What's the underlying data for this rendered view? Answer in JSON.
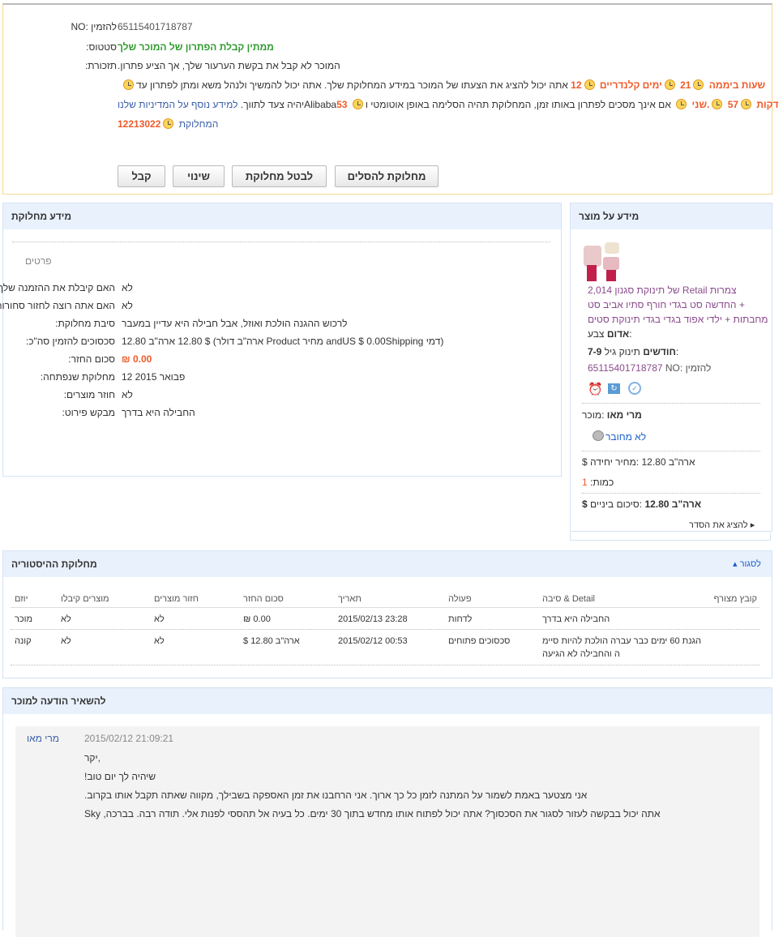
{
  "top": {
    "order_label": "NO: להזמין",
    "order_value": "65115401718787",
    "status_label": ":סטטוס",
    "status_value": "ממתין קבלת הפתרון של המוכר שלך",
    "reminder_label": ":תזכורת",
    "reminder_value": ".המוכר לא קבל את בקשת הערעור שלך, אך הציע פתרון",
    "line1_text": "אתה יכול להציג את הצעתו של המוכר במידע המחלוקת שלך. אתה יכול להמשיך ולנהל משא ומתן לפתרון עד",
    "line1_parts": [
      "12",
      "ימים קלנדריים",
      "21",
      "שעות ביממה"
    ],
    "line2_end": "יהיה צעד לתווך.",
    "line2_link": "למידע נוסף על המדיניות שלנו",
    "line2_brand": "Alibaba",
    "line2_parts": [
      "53",
      "דקות",
      "57",
      ".שני"
    ],
    "line2_text": "אם אינך מסכים לפתרון באותו זמן, המחלוקת תהיה הסלימה באופן אוטומטי ו",
    "line3_num": "12213022",
    "line3_link": "המחלוקת",
    "buttons": {
      "accept": "קבל",
      "modify": "שינוי",
      "cancel": "לבטל מחלוקת",
      "escalate": "מחלוקת להסלים"
    }
  },
  "dispute": {
    "title": "מידע מחלוקת",
    "section": "פרטים",
    "rows": [
      {
        "label": "האם קיבלת את ההזמנה שלך",
        "value": "לא"
      },
      {
        "label": "האם אתה רוצה לחזור סחורות",
        "value": "לא"
      },
      {
        "label": ":סיבת מחלוקת",
        "value": "לרכוש ההגנה הולכת ואוזל, אבל חבילה היא עדיין במעבר"
      },
      {
        "label": ":סכסוכים להזמין סה\"כ",
        "value": "12.80 ארה\"ב דולר) $ 12.80 ארה\"ב Product מחיר andUS $ 0.00Shipping דמי)"
      },
      {
        "label": ":סכום החזר",
        "value": "₪ 0.00"
      },
      {
        "label": ":מחלוקת שנפתחה",
        "value": "12 2015 פבואר"
      },
      {
        "label": ":חוזר מוצרים",
        "value": "לא"
      },
      {
        "label": ":מבקש פירוט",
        "value": "החבילה היא בדרך"
      }
    ]
  },
  "product": {
    "title": "מידע על מוצר",
    "name_lines": [
      "של תינוקת סגנון 2,014 Retail צמרות",
      "החדשה סט בגדי חורף סתיו אביב סט +",
      "מחבתות + ילדי אפוד בגדי בגדי תינוקת סטים"
    ],
    "color_label": "צבע:",
    "color_value": "אדום",
    "age_label": "תינוק גיל:",
    "age_value": "7-9 חודשים",
    "order_label": "NO: להזמין",
    "order_value": "65115401718787",
    "seller_label": ":מוכר",
    "seller_value": "מרי מאו",
    "online_status": "לא מחובר",
    "unit_price_label": ":מחיר יחידה",
    "unit_price_value": "$ ארה\"ב 12.80",
    "qty_label": ":כמות",
    "qty_value": "1",
    "subtotal_label": ":סיכום ביניים",
    "subtotal_value": "$ ארה\"ב 12.80",
    "show_order": "להציג את הסדר"
  },
  "history": {
    "title": "מחלוקת ההיסטוריה",
    "close": "לסגור",
    "headers": [
      "יוזם",
      "מוצרים קיבלו",
      "חזור מוצרים",
      "סכום החזר",
      "תאריך",
      "פעולה",
      "סיבה & Detail",
      "קובץ מצורף"
    ],
    "rows": [
      [
        "מוכר",
        "לא",
        "לא",
        "₪ 0.00",
        "2015/02/13 23:28",
        "לדחות",
        "החבילה היא בדרך",
        ""
      ],
      [
        "קונה",
        "לא",
        "לא",
        "$ ארה\"ב 12.80",
        "2015/02/12 00:53",
        "סכסוכים פתוחים",
        "הגנת 60 ימים כבר עברה הולכת להיות סיימ",
        "ה והחבילה לא הגיעה"
      ]
    ]
  },
  "message": {
    "title": "להשאיר הודעה למוכר",
    "author": "מרי מאו",
    "time": "2015/02/12 21:09:21",
    "lines": [
      "יקר,",
      "!שיהיה לך יום טוב",
      ".אני מצטער באמת לשמור על המתנה לזמן כל כך ארוך. אני הרחבנו את זמן האספקה בשבילך, מקווה שאתה תקבל אותו בקרוב",
      "Sky ,אתה יכול בבקשה לעזור לסגור את הסכסוך? אתה יכול לפתוח אותו מחדש בתוך 30 ימים. כל בעיה אל תהססי לפנות אלי. תודה רבה. בברכה"
    ]
  }
}
